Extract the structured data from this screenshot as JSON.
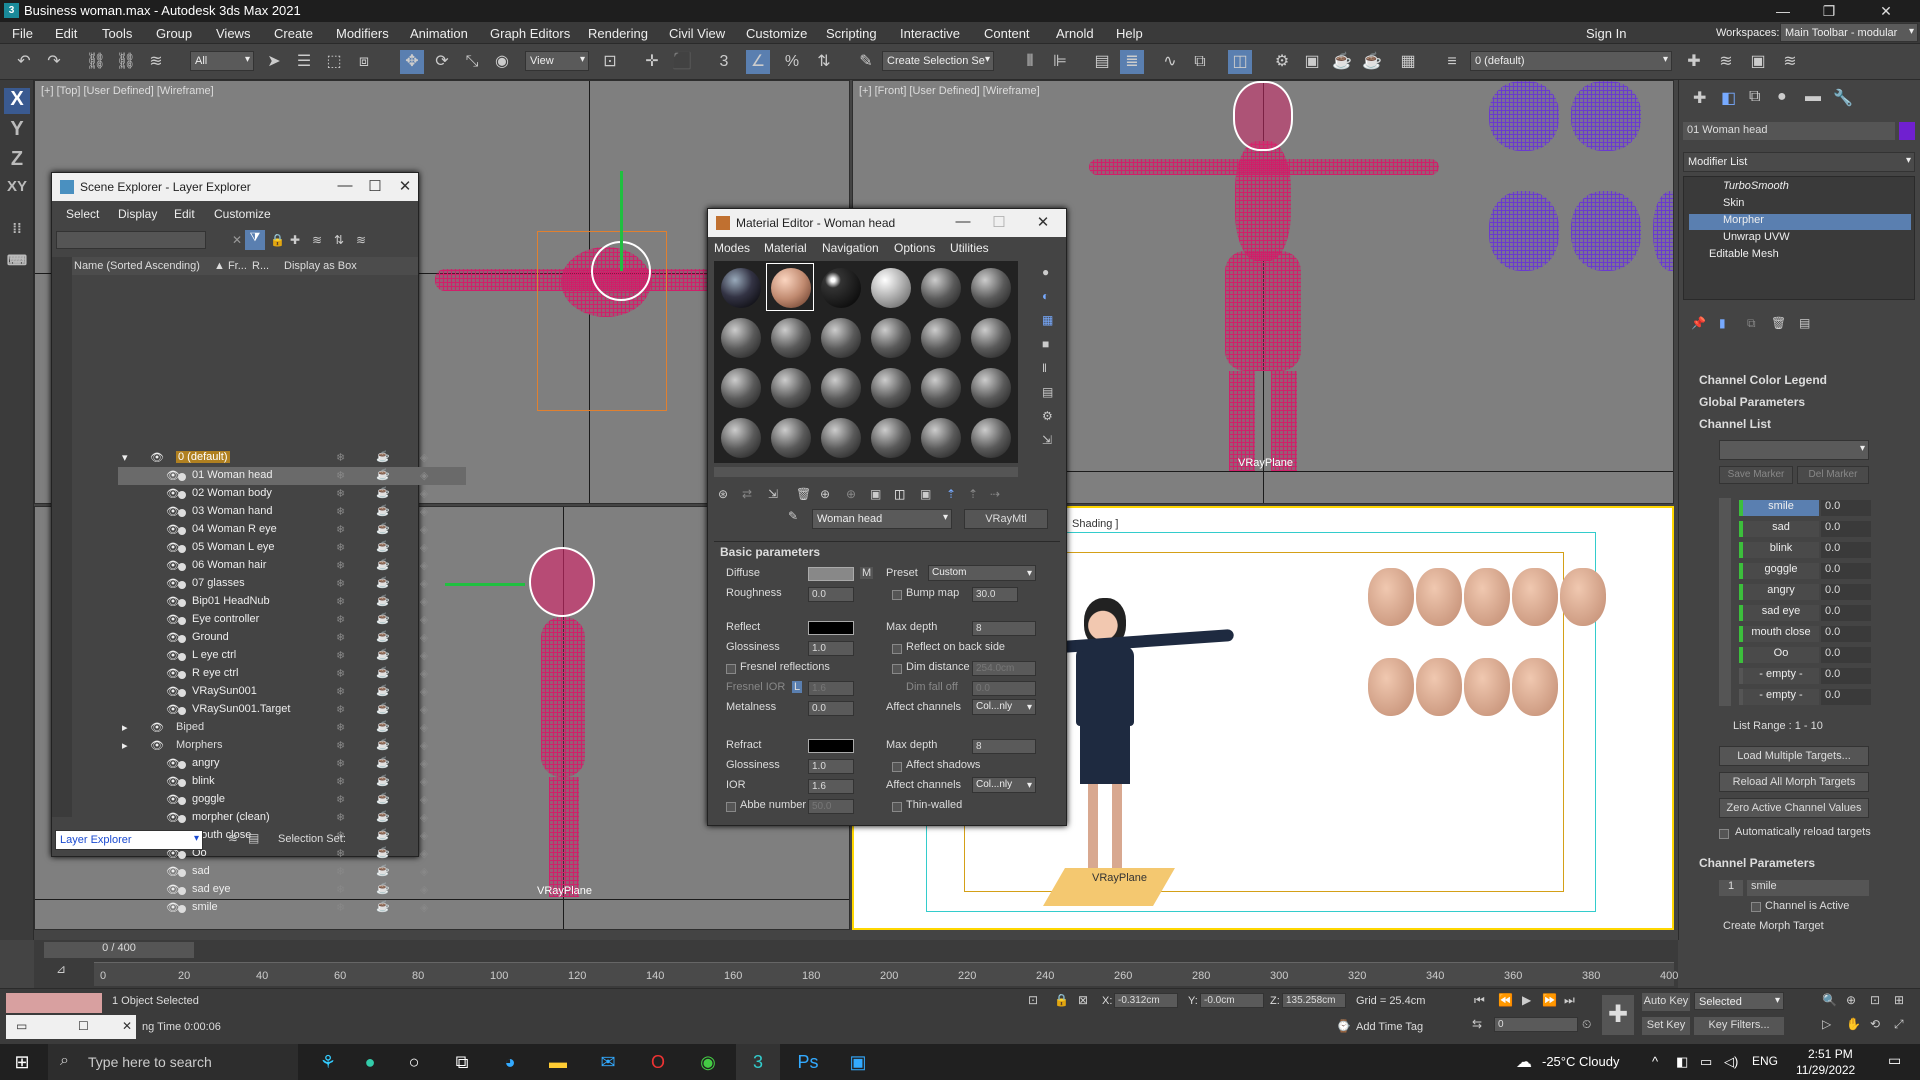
{
  "title": "Business woman.max - Autodesk 3ds Max 2021",
  "window_controls": [
    "—",
    "❐",
    "✕"
  ],
  "menu": [
    "File",
    "Edit",
    "Tools",
    "Group",
    "Views",
    "Create",
    "Modifiers",
    "Animation",
    "Graph Editors",
    "Rendering",
    "Civil View",
    "Customize",
    "Scripting",
    "Interactive",
    "Content",
    "Arnold",
    "Help"
  ],
  "signin": "Sign In",
  "workspaces_label": "Workspaces:",
  "workspace": "Main Toolbar - modular",
  "toolbar": {
    "filter": "All",
    "ref_coord": "View",
    "selection_set": "Create Selection Se",
    "layer": "0 (default)"
  },
  "axes": [
    "X",
    "Y",
    "Z",
    "XY"
  ],
  "viewports": {
    "top": "[+] [Top] [User Defined] [Wireframe]",
    "front": "[+] [Front] [User Defined] [Wireframe]",
    "persp": "Shading ]",
    "vrayplane": "VRayPlane"
  },
  "scene_explorer": {
    "title": "Scene Explorer - Layer Explorer",
    "menu": [
      "Select",
      "Display",
      "Edit",
      "Customize"
    ],
    "columns": [
      "Name (Sorted Ascending)",
      "▲ Fr...",
      "R...",
      "Display as Box"
    ],
    "rows": [
      {
        "name": "0 (default)",
        "level": 0,
        "kind": "layer"
      },
      {
        "name": "01 Woman head",
        "level": 1
      },
      {
        "name": "02 Woman body",
        "level": 1
      },
      {
        "name": "03 Woman hand",
        "level": 1
      },
      {
        "name": "04 Woman R eye",
        "level": 1
      },
      {
        "name": "05 Woman L eye",
        "level": 1
      },
      {
        "name": "06 Woman hair",
        "level": 1
      },
      {
        "name": "07 glasses",
        "level": 1
      },
      {
        "name": "Bip01 HeadNub",
        "level": 1
      },
      {
        "name": "Eye controller",
        "level": 1
      },
      {
        "name": "Ground",
        "level": 1
      },
      {
        "name": "L eye ctrl",
        "level": 1
      },
      {
        "name": "R eye ctrl",
        "level": 1
      },
      {
        "name": "VRaySun001",
        "level": 1
      },
      {
        "name": "VRaySun001.Target",
        "level": 1
      },
      {
        "name": "Biped",
        "level": 0,
        "kind": "layer"
      },
      {
        "name": "Morphers",
        "level": 0,
        "kind": "layer"
      },
      {
        "name": "angry",
        "level": 1
      },
      {
        "name": "blink",
        "level": 1
      },
      {
        "name": "goggle",
        "level": 1
      },
      {
        "name": "morpher (clean)",
        "level": 1
      },
      {
        "name": "mouth close",
        "level": 1
      },
      {
        "name": "Oo",
        "level": 1
      },
      {
        "name": "sad",
        "level": 1
      },
      {
        "name": "sad eye",
        "level": 1
      },
      {
        "name": "smile",
        "level": 1
      }
    ],
    "footer_mode": "Layer Explorer",
    "selection_set": "Selection Set:"
  },
  "material_editor": {
    "title": "Material Editor - Woman head",
    "menu": [
      "Modes",
      "Material",
      "Navigation",
      "Options",
      "Utilities"
    ],
    "material_name": "Woman head",
    "material_type": "VRayMtl",
    "rollout": "Basic parameters",
    "params": {
      "diffuse": "Diffuse",
      "m": "M",
      "preset": "Preset",
      "preset_val": "Custom",
      "roughness": "Roughness",
      "roughness_val": "0.0",
      "bumpmap": "Bump map",
      "bumpmap_val": "30.0",
      "reflect": "Reflect",
      "maxdepth": "Max depth",
      "maxdepth_val": "8",
      "gloss": "Glossiness",
      "gloss_val": "1.0",
      "reflect_back": "Reflect on back side",
      "fresnel": "Fresnel reflections",
      "dim": "Dim distance",
      "dim_val": "254.0cm",
      "fresnel_ior": "Fresnel IOR",
      "fresnel_l": "L",
      "fresnel_ior_val": "1.6",
      "dimfall": "Dim fall off",
      "dimfall_val": "0.0",
      "metal": "Metalness",
      "metal_val": "0.0",
      "affect": "Affect channels",
      "affect_val": "Col...nly",
      "refract": "Refract",
      "rmaxdepth": "Max depth",
      "rmaxdepth_val": "8",
      "rgloss": "Glossiness",
      "rgloss_val": "1.0",
      "affect_shadows": "Affect shadows",
      "ior": "IOR",
      "ior_val": "1.6",
      "raffect": "Affect channels",
      "raffect_val": "Col...nly",
      "abbe": "Abbe number",
      "abbe_val": "50.0",
      "thin": "Thin-walled"
    }
  },
  "command_panel": {
    "object_name": "01 Woman head",
    "modifier_list": "Modifier List",
    "stack": [
      "TurboSmooth",
      "Skin",
      "Morpher",
      "Unwrap UVW",
      "Editable Mesh"
    ],
    "rollouts": [
      "Channel Color Legend",
      "Global Parameters",
      "Channel List"
    ],
    "save_marker": "Save Marker",
    "del_marker": "Del Marker",
    "channels": [
      "smile",
      "sad",
      "blink",
      "goggle",
      "angry",
      "sad eye",
      "mouth close",
      "Oo",
      "- empty -",
      "- empty -"
    ],
    "channel_value": "0.0",
    "list_range": "List Range :   1 - 10",
    "buttons": [
      "Load Multiple Targets...",
      "Reload All Morph Targets",
      "Zero Active Channel Values"
    ],
    "auto_reload": "Automatically reload targets",
    "channel_params": "Channel Parameters",
    "channel_num": "1",
    "channel_name": "smile",
    "channel_active": "Channel is Active",
    "create_target": "Create Morph Target"
  },
  "timeline": {
    "frame": "0 / 400",
    "ticks": [
      "0",
      "20",
      "40",
      "60",
      "80",
      "100",
      "120",
      "140",
      "160",
      "180",
      "200",
      "220",
      "240",
      "260",
      "280",
      "300",
      "320",
      "340",
      "360",
      "380",
      "400"
    ]
  },
  "status": {
    "selected": "1 Object Selected",
    "rendering_time": "ng Time  0:00:06",
    "x_label": "X:",
    "x": "-0.312cm",
    "y_label": "Y:",
    "y": "-0.0cm",
    "z_label": "Z:",
    "z": "135.258cm",
    "grid": "Grid = 25.4cm",
    "add_time_tag": "Add Time Tag",
    "auto_key": "Auto Key",
    "selected_dd": "Selected",
    "set_key": "Set Key",
    "key_filters": "Key Filters...",
    "frame_num": "0"
  },
  "taskbar": {
    "search": "Type here to search",
    "weather": "-25°C  Cloudy",
    "lang": "ENG",
    "time": "2:51 PM",
    "date": "11/29/2022"
  }
}
